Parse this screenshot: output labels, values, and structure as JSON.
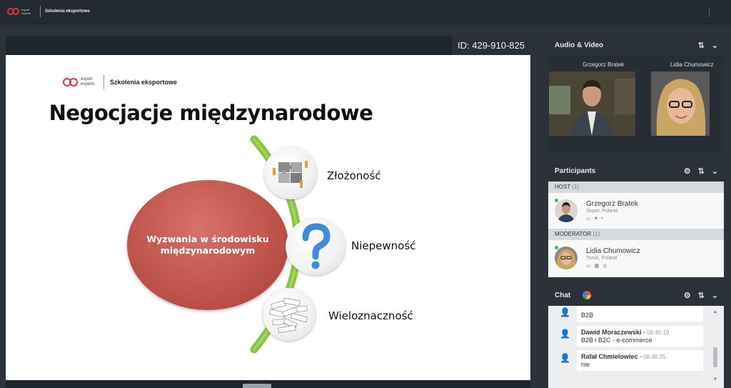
{
  "app": {
    "brand_small": "export experts",
    "brand_big": "Szkolenia eksportowe"
  },
  "presentation": {
    "meeting_id": "ID: 429-910-825",
    "slide": {
      "brand_small": "export experts",
      "brand_big": "Szkolenia eksportowe",
      "title": "Negocjacje międzynarodowe",
      "center_text": "Wyzwania w środowisku\nmiędzynarodowym",
      "items": [
        {
          "label": "Złożoność"
        },
        {
          "label": "Niepewność"
        },
        {
          "label": "Wieloznaczność"
        }
      ]
    }
  },
  "audio_video": {
    "title": "Audio & Video",
    "participants": [
      {
        "name": "Grzegorz Bratek"
      },
      {
        "name": "Lidia Chumowicz"
      }
    ]
  },
  "participants_panel": {
    "title": "Participants",
    "groups": [
      {
        "role": "HOST",
        "count": "(1)",
        "person": {
          "name": "Grzegorz Bratek",
          "location": "Sopot, Poland"
        }
      },
      {
        "role": "MODERATOR",
        "count": "(1)",
        "person": {
          "name": "Lidia Chumowicz",
          "location": "Toruń, Poland"
        }
      }
    ]
  },
  "chat": {
    "title": "Chat",
    "messages": [
      {
        "author": "",
        "time": "",
        "text": "B2B"
      },
      {
        "author": "Dawid Moraczewski",
        "time": "• 08:46:19",
        "text": "B2B i B2C - e-commerce"
      },
      {
        "author": "Rafał Chmielowiec",
        "time": "• 08:48:25",
        "text": "nie"
      }
    ]
  },
  "colors": {
    "brand_red": "#e8303a",
    "ellipse": "#c45a52",
    "arc_green": "#8cc63f",
    "online": "#44b655"
  }
}
